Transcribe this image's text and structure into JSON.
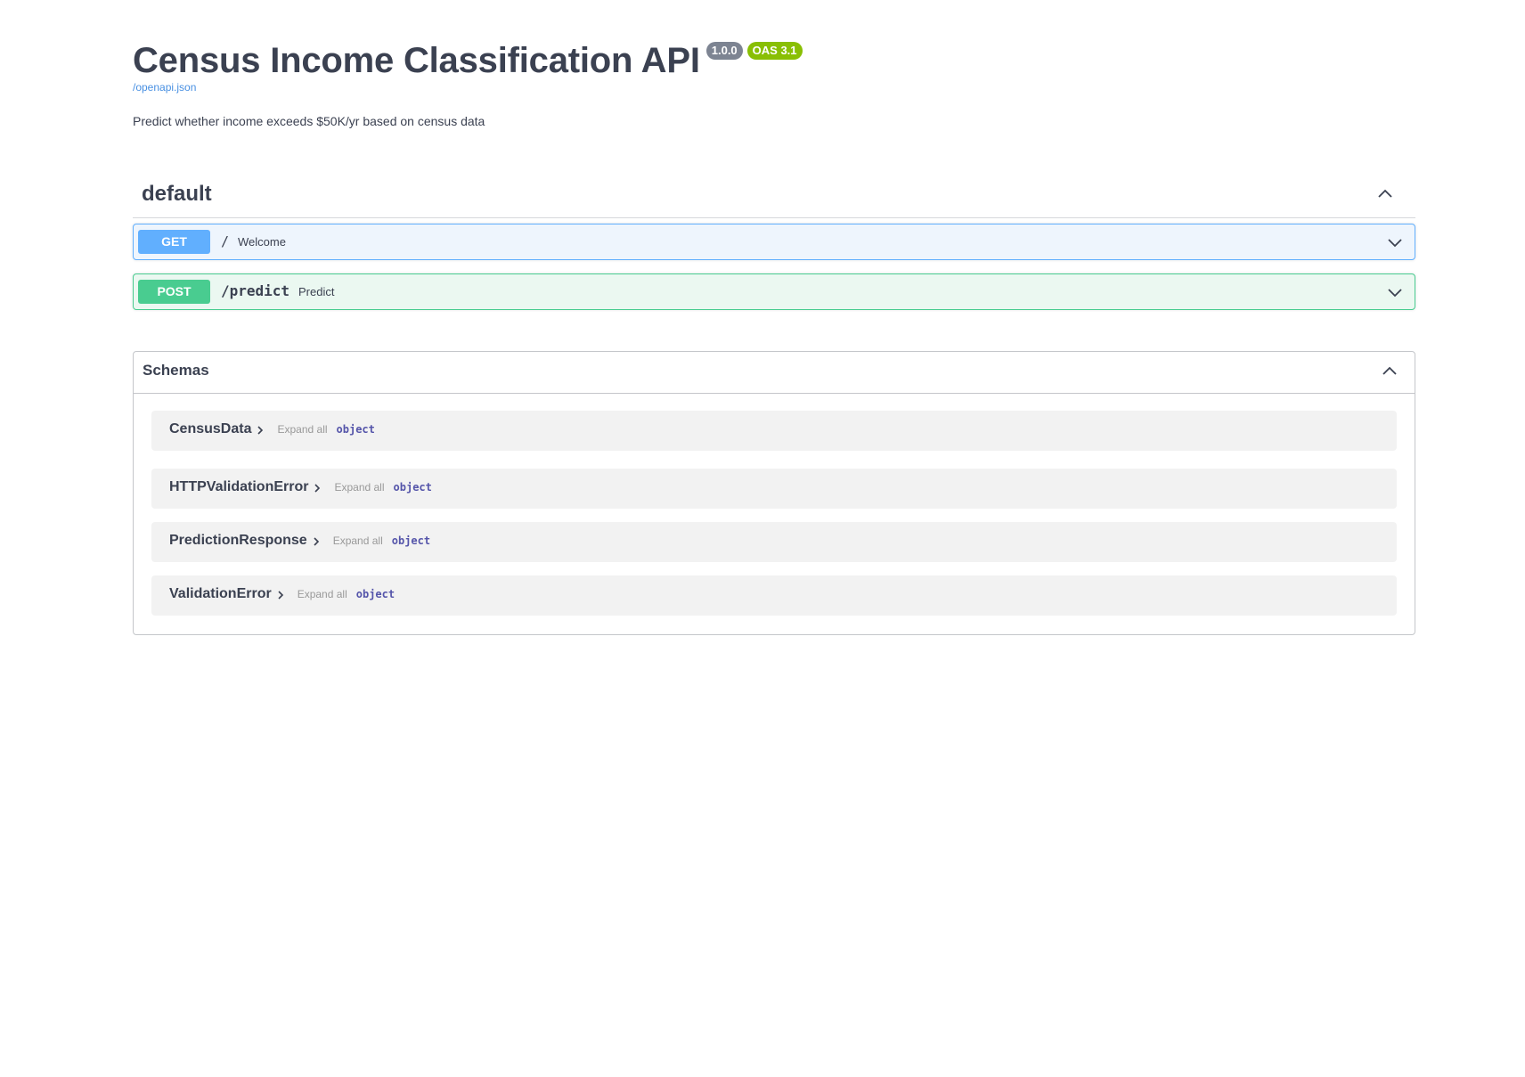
{
  "header": {
    "title": "Census Income Classification API",
    "version_badge": "1.0.0",
    "oas_badge": "OAS 3.1",
    "spec_link": "/openapi.json",
    "description": "Predict whether income exceeds $50K/yr based on census data"
  },
  "tag": {
    "name": "default",
    "toggle_icon": "chevron-up-icon"
  },
  "operations": [
    {
      "method": "GET",
      "path": "/",
      "summary": "Welcome",
      "color": "#61affe",
      "toggle_icon": "chevron-down-icon"
    },
    {
      "method": "POST",
      "path": "/predict",
      "summary": "Predict",
      "color": "#49cc90",
      "toggle_icon": "chevron-down-icon"
    }
  ],
  "schemas": {
    "title": "Schemas",
    "toggle_icon": "chevron-up-icon",
    "items": [
      {
        "name": "CensusData",
        "expand_label": "Expand all",
        "type": "object"
      },
      {
        "name": "HTTPValidationError",
        "expand_label": "Expand all",
        "type": "object"
      },
      {
        "name": "PredictionResponse",
        "expand_label": "Expand all",
        "type": "object"
      },
      {
        "name": "ValidationError",
        "expand_label": "Expand all",
        "type": "object"
      }
    ]
  }
}
